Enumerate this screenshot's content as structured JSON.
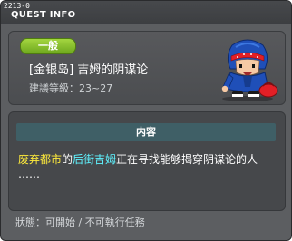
{
  "window": {
    "quest_id": "2213-0",
    "title": "QUEST INFO"
  },
  "quest": {
    "category": "一般",
    "name": "[金银岛] 吉姆的阴谋论",
    "level_label": "建議等級：",
    "level_range": "23~27"
  },
  "details": {
    "header": "内容",
    "description": {
      "place": "废弃都市",
      "text_1": "的",
      "npc": "后街吉姆",
      "text_2": "正在寻找能够揭穿阴谋论的人",
      "text_3": "……"
    }
  },
  "status": {
    "label": "狀態：",
    "value": "可開始 / 不可執行任務"
  },
  "colors": {
    "window_bg": "#5c5e61",
    "badge_green": "#8cc43a",
    "header_teal": "#3f5f66",
    "place_yellow": "#ffeb3b",
    "npc_cyan": "#5ff3ff"
  }
}
